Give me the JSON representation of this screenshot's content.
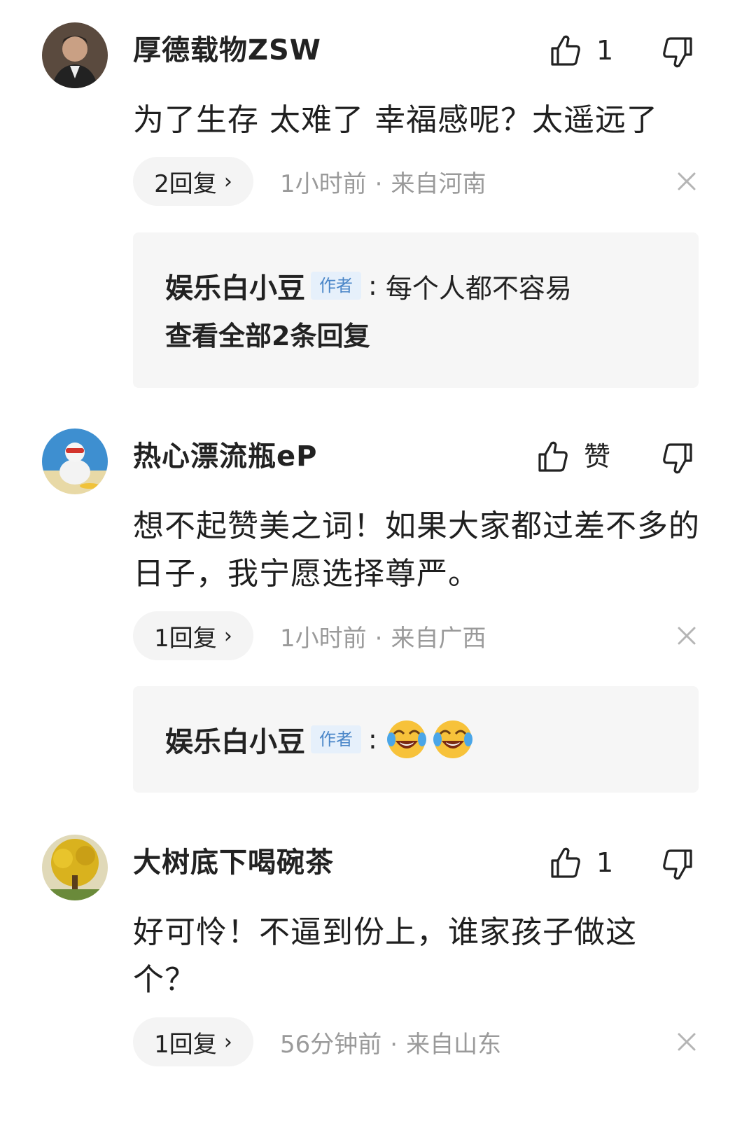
{
  "comments": [
    {
      "username": "厚德载物ZSW",
      "like_label": "1",
      "content": "为了生存 太难了 幸福感呢？太遥远了",
      "reply_count_label": "2回复",
      "time": "1小时前",
      "location": "来自河南",
      "reply": {
        "author": "娱乐白小豆",
        "author_tag": "作者",
        "text": "每个人都不容易",
        "see_all": "查看全部2条回复"
      },
      "avatar": "man-portrait-avatar"
    },
    {
      "username": "热心漂流瓶eP",
      "like_label": "赞",
      "content": "想不起赞美之词！如果大家都过差不多的日子，我宁愿选择尊严。",
      "reply_count_label": "1回复",
      "time": "1小时前",
      "location": "来自广西",
      "reply": {
        "author": "娱乐白小豆",
        "author_tag": "作者",
        "emojis": [
          "crying-laughing-emoji",
          "crying-laughing-emoji"
        ]
      },
      "avatar": "dog-beach-avatar"
    },
    {
      "username": "大树底下喝碗茶",
      "like_label": "1",
      "content": "好可怜！不逼到份上，谁家孩子做这个？",
      "reply_count_label": "1回复",
      "time": "56分钟前",
      "location": "来自山东",
      "avatar": "yellow-tree-avatar"
    }
  ],
  "colors": {
    "meta_gray": "#9a9a9a",
    "reply_bg": "#f6f6f6",
    "author_tag_bg": "#e6f0fb",
    "author_tag_text": "#4a86c8"
  },
  "meta_separator": "·"
}
